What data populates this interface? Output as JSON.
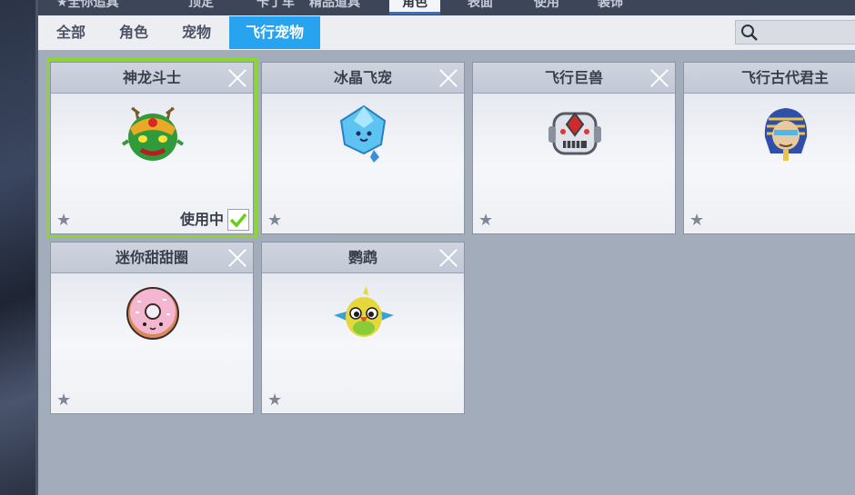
{
  "top_tabs": [
    "★全你追具",
    "顶定",
    "卡丁车",
    "精品道具",
    "角色",
    "表面",
    "使用",
    "装饰"
  ],
  "sub_tabs": [
    "全部",
    "角色",
    "宠物",
    "飞行宠物"
  ],
  "active_sub_tab": "飞行宠物",
  "cards": [
    {
      "title": "神龙斗士",
      "selected": true,
      "in_use_label": "使用中",
      "pet_icon": "dragon-warrior-icon"
    },
    {
      "title": "冰晶飞宠",
      "selected": false,
      "pet_icon": "ice-crystal-icon"
    },
    {
      "title": "飞行巨兽",
      "selected": false,
      "pet_icon": "robot-beast-icon"
    },
    {
      "title": "飞行古代君主",
      "selected": false,
      "pet_icon": "pharaoh-icon"
    },
    {
      "title": "迷你甜甜圈",
      "selected": false,
      "pet_icon": "donut-icon"
    },
    {
      "title": "鹦鹉",
      "selected": false,
      "pet_icon": "parrot-icon"
    }
  ],
  "colors": {
    "accent": "#27a3f0",
    "selected_outline": "#8ad82a",
    "check": "#6ccc1e"
  }
}
